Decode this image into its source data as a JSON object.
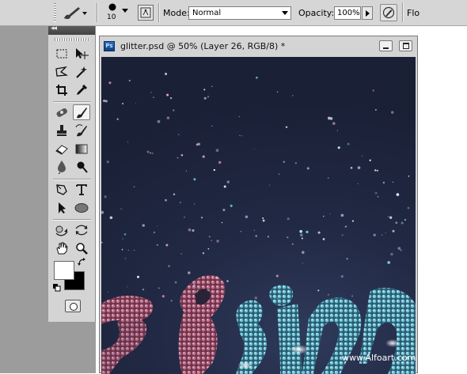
{
  "options_bar": {
    "brush_size": "10",
    "mode_label": "Mode:",
    "mode_value": "Normal",
    "opacity_label": "Opacity:",
    "opacity_value": "100%",
    "flow_label": "Flo"
  },
  "tools_panel": {
    "collapse_glyph": "◂◂",
    "foreground_color": "#ffffff",
    "background_color": "#000000",
    "tools": [
      {
        "name": "marquee-tool-icon"
      },
      {
        "name": "move-tool-icon"
      },
      {
        "name": "lasso-tool-icon"
      },
      {
        "name": "magic-wand-tool-icon"
      },
      {
        "name": "crop-tool-icon"
      },
      {
        "name": "eyedropper-tool-icon"
      },
      {
        "name": "healing-brush-tool-icon"
      },
      {
        "name": "brush-tool-icon",
        "active": true
      },
      {
        "name": "clone-stamp-tool-icon"
      },
      {
        "name": "history-brush-tool-icon"
      },
      {
        "name": "eraser-tool-icon"
      },
      {
        "name": "gradient-tool-icon"
      },
      {
        "name": "blur-tool-icon"
      },
      {
        "name": "dodge-tool-icon"
      },
      {
        "name": "pen-tool-icon"
      },
      {
        "name": "type-tool-icon"
      },
      {
        "name": "path-selection-tool-icon"
      },
      {
        "name": "ellipse-tool-icon"
      },
      {
        "name": "3d-rotate-tool-icon"
      },
      {
        "name": "3d-orbit-tool-icon"
      },
      {
        "name": "hand-tool-icon"
      },
      {
        "name": "zoom-tool-icon"
      }
    ]
  },
  "document": {
    "app_icon_text": "Ps",
    "title": "glitter.psd @ 50% (Layer 26, RGB/8) *",
    "watermark": "www.Alfoart.com"
  },
  "colors": {
    "canvas_dark": "#1e2540",
    "pink_glitter": "#c0708e",
    "blue_glitter": "#6fc4d6"
  }
}
